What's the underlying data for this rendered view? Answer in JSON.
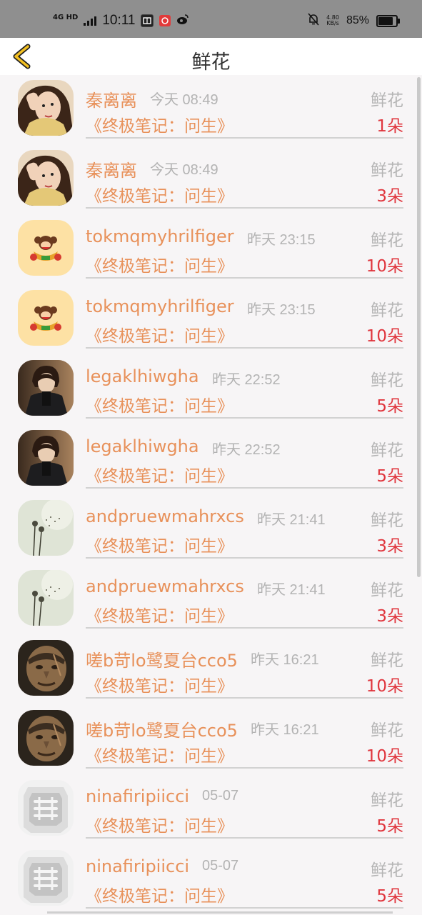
{
  "status_bar": {
    "network": "4G HD",
    "time": "10:11",
    "speed_value": "4.80",
    "speed_unit": "KB/s",
    "battery_percent": "85%",
    "battery_level": 0.85,
    "app_icons": [
      "yiyi-app-icon",
      "taobao-app-icon",
      "weibo-icon"
    ]
  },
  "nav": {
    "title": "鲜花",
    "back_icon": "chevron-left-icon",
    "accent": "#f3c022"
  },
  "colors": {
    "name": "#e8915a",
    "time": "#b3b3b3",
    "count": "#e0363e",
    "divider": "#d2d2d2"
  },
  "records": [
    {
      "name": "秦离离",
      "time": "今天 08:49",
      "gift": "鲜花",
      "book": "《终极笔记：问生》",
      "count": "1朵",
      "avatar": "girl-portrait"
    },
    {
      "name": "秦离离",
      "time": "今天 08:49",
      "gift": "鲜花",
      "book": "《终极笔记：问生》",
      "count": "3朵",
      "avatar": "girl-portrait"
    },
    {
      "name": "tokmqmyhrilfiger",
      "time": "昨天 23:15",
      "gift": "鲜花",
      "book": "《终极笔记：问生》",
      "count": "10朵",
      "avatar": "monkey-cartoon"
    },
    {
      "name": "tokmqmyhrilfiger",
      "time": "昨天 23:15",
      "gift": "鲜花",
      "book": "《终极笔记：问生》",
      "count": "10朵",
      "avatar": "monkey-cartoon"
    },
    {
      "name": "legaklhiwgha",
      "time": "昨天 22:52",
      "gift": "鲜花",
      "book": "《终极笔记：问生》",
      "count": "5朵",
      "avatar": "man-dark-coat"
    },
    {
      "name": "legaklhiwgha",
      "time": "昨天 22:52",
      "gift": "鲜花",
      "book": "《终极笔记：问生》",
      "count": "5朵",
      "avatar": "man-dark-coat"
    },
    {
      "name": "andpruewmahrxcs",
      "time": "昨天 21:41",
      "gift": "鲜花",
      "book": "《终极笔记：问生》",
      "count": "3朵",
      "avatar": "dandelion"
    },
    {
      "name": "andpruewmahrxcs",
      "time": "昨天 21:41",
      "gift": "鲜花",
      "book": "《终极笔记：问生》",
      "count": "3朵",
      "avatar": "dandelion"
    },
    {
      "name": "嗟b苛lo鹭夏台cco5",
      "time": "昨天 16:21",
      "gift": "鲜花",
      "book": "《终极笔记：问生》",
      "count": "10朵",
      "avatar": "game-character"
    },
    {
      "name": "嗟b苛lo鹭夏台cco5",
      "time": "昨天 16:21",
      "gift": "鲜花",
      "book": "《终极笔记：问生》",
      "count": "10朵",
      "avatar": "game-character"
    },
    {
      "name": "ninafiripiicci",
      "time": "05-07",
      "gift": "鲜花",
      "book": "《终极笔记：问生》",
      "count": "5朵",
      "avatar": "grey-stamp"
    },
    {
      "name": "ninafiripiicci",
      "time": "05-07",
      "gift": "鲜花",
      "book": "《终极笔记：问生》",
      "count": "5朵",
      "avatar": "grey-stamp"
    }
  ]
}
